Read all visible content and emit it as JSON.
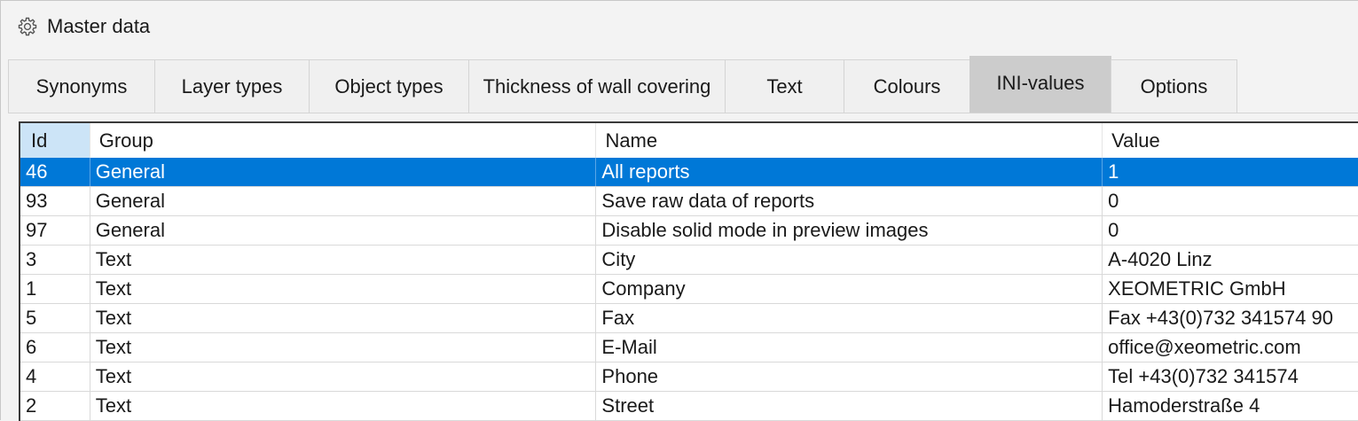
{
  "window": {
    "title": "Master data",
    "icon": "gear-icon"
  },
  "tabs": [
    {
      "label": "Synonyms",
      "active": false
    },
    {
      "label": "Layer types",
      "active": false
    },
    {
      "label": "Object types",
      "active": false
    },
    {
      "label": "Thickness of wall covering",
      "active": false
    },
    {
      "label": "Text",
      "active": false
    },
    {
      "label": "Colours",
      "active": false
    },
    {
      "label": "INI-values",
      "active": true
    },
    {
      "label": "Options",
      "active": false
    }
  ],
  "table": {
    "columns": [
      "Id",
      "Group",
      "Name",
      "Value"
    ],
    "selected_row": 0,
    "rows": [
      [
        "46",
        "General",
        "All reports",
        "1"
      ],
      [
        "93",
        "General",
        "Save raw data of reports",
        "0"
      ],
      [
        "97",
        "General",
        "Disable solid mode in preview images",
        "0"
      ],
      [
        "3",
        "Text",
        "City",
        "A-4020 Linz"
      ],
      [
        "1",
        "Text",
        "Company",
        "XEOMETRIC GmbH"
      ],
      [
        "5",
        "Text",
        "Fax",
        "Fax +43(0)732 341574 90"
      ],
      [
        "6",
        "Text",
        "E-Mail",
        "office@xeometric.com"
      ],
      [
        "4",
        "Text",
        "Phone",
        "Tel +43(0)732 341574"
      ],
      [
        "2",
        "Text",
        "Street",
        "Hamoderstraße 4"
      ]
    ]
  },
  "colors": {
    "selection": "#0078d7",
    "active_tab": "#cccccc",
    "selected_column_header": "#cce4f7"
  }
}
